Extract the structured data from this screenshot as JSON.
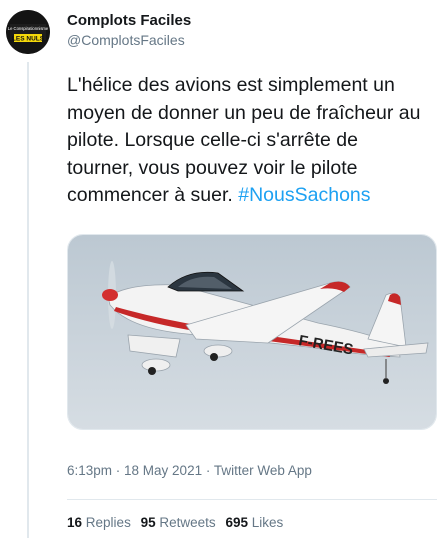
{
  "author": {
    "display_name": "Complots Faciles",
    "handle": "@ComplotsFaciles",
    "avatar": {
      "icon": "conspiracy-logo-icon",
      "text_line1": "Le Conspirationnisme",
      "text_line2": "LES NULS"
    }
  },
  "tweet": {
    "text": "L'hélice des avions est simplement un moyen de donner un peu de fraîcheur au pilote. Lorsque celle-ci s'arrête de tourner, vous pouvez voir le pilote commencer à suer.",
    "hashtag": "#NousSachons",
    "hashtag_color": "#1da1f2"
  },
  "media": {
    "icon": "airplane-photo",
    "registration": "F-REES",
    "sky_color": "#c9d3db"
  },
  "meta": {
    "time": "6:13pm",
    "separator": " · ",
    "date": "18 May 2021",
    "source": "Twitter Web App"
  },
  "stats": {
    "replies_count": "16",
    "replies_label": "Replies",
    "retweets_count": "95",
    "retweets_label": "Retweets",
    "likes_count": "695",
    "likes_label": "Likes"
  }
}
